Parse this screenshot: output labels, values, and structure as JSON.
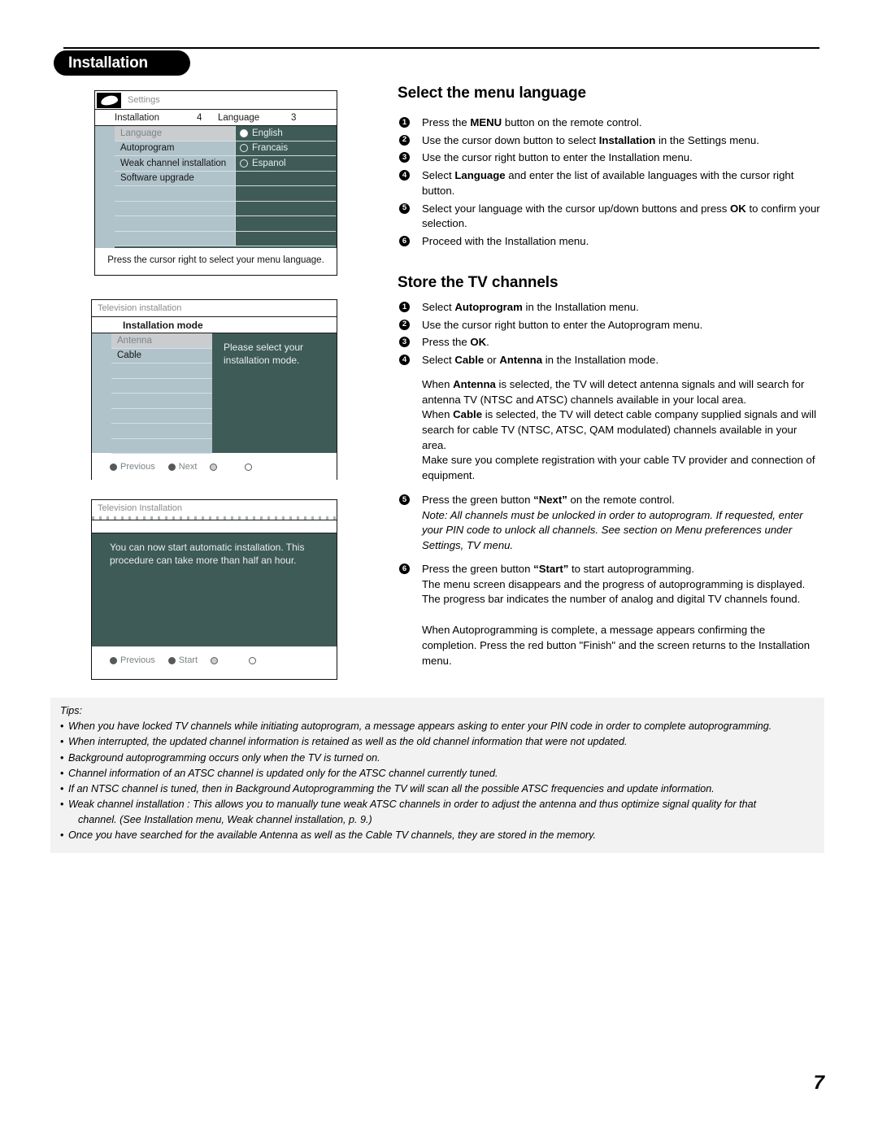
{
  "chapter": {
    "tab_label": "Installation"
  },
  "page_number": "7",
  "screens": {
    "language": {
      "logo_icon": "philips-shield-icon",
      "topbar_title": "Settings",
      "breadcrumb": [
        {
          "label": "Installation",
          "count": "4"
        },
        {
          "label": "Language",
          "count": "3"
        }
      ],
      "menu_items": [
        {
          "label": "Language",
          "selected": true
        },
        {
          "label": "Autoprogram",
          "selected": false
        },
        {
          "label": "Weak channel installation",
          "selected": false
        },
        {
          "label": "Software upgrade",
          "selected": false
        },
        {
          "label": "",
          "selected": false
        },
        {
          "label": "",
          "selected": false
        },
        {
          "label": "",
          "selected": false
        },
        {
          "label": "",
          "selected": false
        }
      ],
      "options": [
        {
          "label": "English",
          "checked": true
        },
        {
          "label": "Francais",
          "checked": false
        },
        {
          "label": "Espanol",
          "checked": false
        },
        {
          "label": "",
          "checked": null
        },
        {
          "label": "",
          "checked": null
        },
        {
          "label": "",
          "checked": null
        },
        {
          "label": "",
          "checked": null
        },
        {
          "label": "",
          "checked": null
        }
      ],
      "help_text": "Press the cursor right to select your menu language."
    },
    "mode": {
      "topbar_title": "Television installation",
      "section_title": "Installation mode",
      "menu_items": [
        {
          "label": "Antenna",
          "selected": true
        },
        {
          "label": "Cable",
          "selected": false
        },
        {
          "label": "",
          "selected": false
        },
        {
          "label": "",
          "selected": false
        },
        {
          "label": "",
          "selected": false
        },
        {
          "label": "",
          "selected": false
        },
        {
          "label": "",
          "selected": false
        },
        {
          "label": "",
          "selected": false
        }
      ],
      "info_text": "Please select your installation mode.",
      "footer_buttons": [
        {
          "label": "Previous",
          "style": "filled"
        },
        {
          "label": "Next",
          "style": "filled"
        },
        {
          "label": "",
          "style": "hollow"
        },
        {
          "label": "",
          "style": "empty"
        }
      ]
    },
    "start": {
      "topbar_title": "Television Installation",
      "info_text": "You can now start automatic installation. This procedure can take more than half an hour.",
      "footer_buttons": [
        {
          "label": "Previous",
          "style": "filled"
        },
        {
          "label": "Start",
          "style": "filled"
        },
        {
          "label": "",
          "style": "hollow"
        },
        {
          "label": "",
          "style": "empty"
        }
      ]
    }
  },
  "sections": {
    "language": {
      "title": "Select the menu language",
      "steps": [
        "Press the <b>MENU</b> button on the remote control.",
        "Use the cursor down button to select <b>Installation</b> in the Settings menu.",
        "Use the cursor right button to enter the Installation menu.",
        "Select <b>Language</b> and enter the list of available languages with the cursor right button.",
        "Select your language with the cursor up/down buttons and press <b>OK</b> to confirm your selection.",
        "Proceed with the Installation menu."
      ]
    },
    "channels": {
      "title": "Store the TV channels",
      "steps": [
        "Select <b>Autoprogram</b> in the Installation menu.",
        "Use the cursor right button to enter the Autoprogram menu.",
        "Press the <b>OK</b>.",
        "Select <b>Cable</b> or <b>Antenna</b> in the Installation mode."
      ],
      "antenna_para": "When <b>Antenna</b> is selected, the TV will detect antenna signals and will search for antenna TV (NTSC and ATSC) channels available in your local area.",
      "cable_para": "When <b>Cable</b> is selected, the TV will detect cable company supplied signals and will search for cable TV (NTSC, ATSC, QAM modulated) channels available in your area.",
      "registration_para": "Make sure you complete registration with your cable TV provider and connection of equipment.",
      "step5": "Press the green button <b>“Next”</b> on the remote control.",
      "step5_note": "Note: All channels must be unlocked in order to autoprogram. If requested, enter your PIN code to unlock all channels. See section on Menu preferences under Settings, TV menu.",
      "step6": "Press the green button <b>“Start”</b> to start autoprogramming.",
      "step6_para": "The menu screen disappears and the progress of autoprogramming is displayed. The progress bar indicates the number of analog and digital TV channels found.",
      "complete_para": "When Autoprogramming is complete, a message appears confirming the completion. Press the red button \"Finish\" and the screen returns to the Installation menu."
    }
  },
  "tips": {
    "title": "Tips:",
    "items": [
      "When you have locked TV channels while initiating autoprogram, a message appears asking to enter your PIN code in order to complete autoprogramming.",
      "When interrupted, the updated channel information is retained as well as the old channel information that were not updated.",
      "Background autoprogramming occurs only when the TV is turned on.",
      "Channel information of an ATSC channel is updated only for the ATSC channel currently tuned.",
      "If an NTSC channel is tuned, then in Background Autoprogramming the TV will scan all the possible ATSC frequencies and update information.",
      "Weak channel installation : This allows you to manually tune weak ATSC channels in order to adjust the antenna and thus optimize signal quality for that",
      "Once you have searched for the available Antenna as well as the Cable TV channels, they are stored in the memory."
    ],
    "item6_continuation": "channel. (See Installation menu, Weak channel installation, p. 9.)"
  },
  "colors": {
    "menu_panel": "#b0c2ca",
    "menu_selected": "#c9cdd0",
    "option_panel": "#3f5b57",
    "tips_background": "#f2f2f2",
    "tab_background": "#000000"
  }
}
